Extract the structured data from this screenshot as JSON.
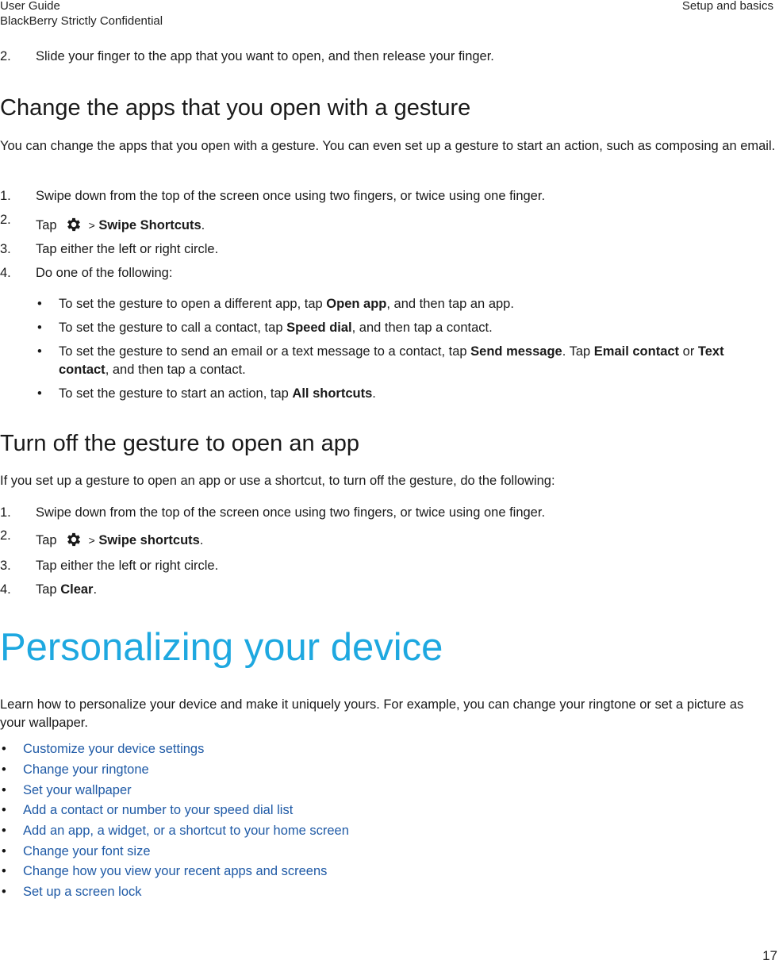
{
  "header": {
    "doc_title": "User Guide",
    "confidentiality": "BlackBerry Strictly Confidential",
    "section": "Setup and basics"
  },
  "intro_step": {
    "num": "2.",
    "text": "Slide your finger to the app that you want to open, and then release your finger."
  },
  "section_change": {
    "title": "Change the apps that you open with a gesture",
    "desc": "You can change the apps that you open with a gesture. You can even set up a gesture to start an action, such as composing an email.",
    "steps": [
      {
        "num": "1.",
        "text": "Swipe down from the top of the screen once using two fingers, or twice using one finger."
      },
      {
        "num": "2.",
        "pre": "Tap",
        "sep": ">",
        "bold": "Swipe Shortcuts",
        "post": "."
      },
      {
        "num": "3.",
        "text": "Tap either the left or right circle."
      },
      {
        "num": "4.",
        "text": "Do one of the following:"
      }
    ],
    "bullets": [
      {
        "pre": "To set the gesture to open a different app, tap ",
        "b1": "Open app",
        "post": ", and then tap an app."
      },
      {
        "pre": "To set the gesture to call a contact, tap ",
        "b1": "Speed dial",
        "post": ", and then tap a contact."
      },
      {
        "pre": "To set the gesture to send an email or a text message to a contact, tap ",
        "b1": "Send message",
        "mid1": ". Tap ",
        "b2": "Email contact",
        "mid2": " or ",
        "b3": "Text contact",
        "post": ", and then tap a contact."
      },
      {
        "pre": "To set the gesture to start an action, tap ",
        "b1": "All shortcuts",
        "post": "."
      }
    ]
  },
  "section_turnoff": {
    "title": "Turn off the gesture to open an app",
    "desc": "If you set up a gesture to open an app or use a shortcut, to turn off the gesture, do the following:",
    "steps": [
      {
        "num": "1.",
        "text": "Swipe down from the top of the screen once using two fingers, or twice using one finger."
      },
      {
        "num": "2.",
        "pre": "Tap",
        "sep": ">",
        "bold": "Swipe shortcuts",
        "post": "."
      },
      {
        "num": "3.",
        "text": "Tap either the left or right circle."
      },
      {
        "num": "4.",
        "pre": "Tap ",
        "bold": "Clear",
        "post": "."
      }
    ]
  },
  "chapter": {
    "title": "Personalizing your device",
    "color": "#1ea8e0",
    "desc": "Learn how to personalize your device and make it uniquely yours. For example, you can change your ringtone or set a picture as your wallpaper.",
    "links": [
      "Customize your device settings",
      "Change your ringtone",
      "Set your wallpaper",
      "Add a contact or number to your speed dial list",
      "Add an app, a widget, or a shortcut to your home screen",
      "Change your font size",
      "Change how you view your recent apps and screens",
      "Set up a screen lock"
    ],
    "link_color": "#1f5aa6"
  },
  "bullet_glyph": "•",
  "icons": {
    "settings": "gear-icon"
  },
  "page_number": "17"
}
